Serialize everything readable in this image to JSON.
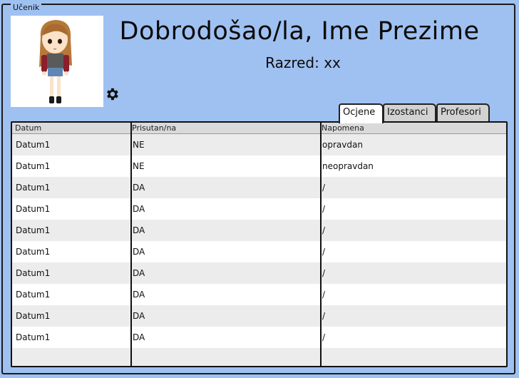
{
  "window": {
    "title": "Učenik"
  },
  "header": {
    "welcome": "Dobrodošao/la, Ime Prezime",
    "grade": "Razred: xx"
  },
  "icons": {
    "settings": "gear-icon",
    "avatar": "student-avatar-image"
  },
  "tabs": [
    {
      "label": "Ocjene",
      "active": true
    },
    {
      "label": "Izostanci",
      "active": false
    },
    {
      "label": "Profesori",
      "active": false
    }
  ],
  "table": {
    "headers": [
      "Datum",
      "Prisutan/na",
      "Napomena"
    ],
    "rows": [
      [
        "Datum1",
        "NE",
        "opravdan"
      ],
      [
        "Datum1",
        "NE",
        "neopravdan"
      ],
      [
        "Datum1",
        "DA",
        "/"
      ],
      [
        "Datum1",
        "DA",
        "/"
      ],
      [
        "Datum1",
        "DA",
        "/"
      ],
      [
        "Datum1",
        "DA",
        "/"
      ],
      [
        "Datum1",
        "DA",
        "/"
      ],
      [
        "Datum1",
        "DA",
        "/"
      ],
      [
        "Datum1",
        "DA",
        "/"
      ],
      [
        "Datum1",
        "DA",
        "/"
      ]
    ]
  },
  "colors": {
    "background": "#9fc1f1",
    "row_alt": "#ececec",
    "header_bg": "#dadada"
  }
}
